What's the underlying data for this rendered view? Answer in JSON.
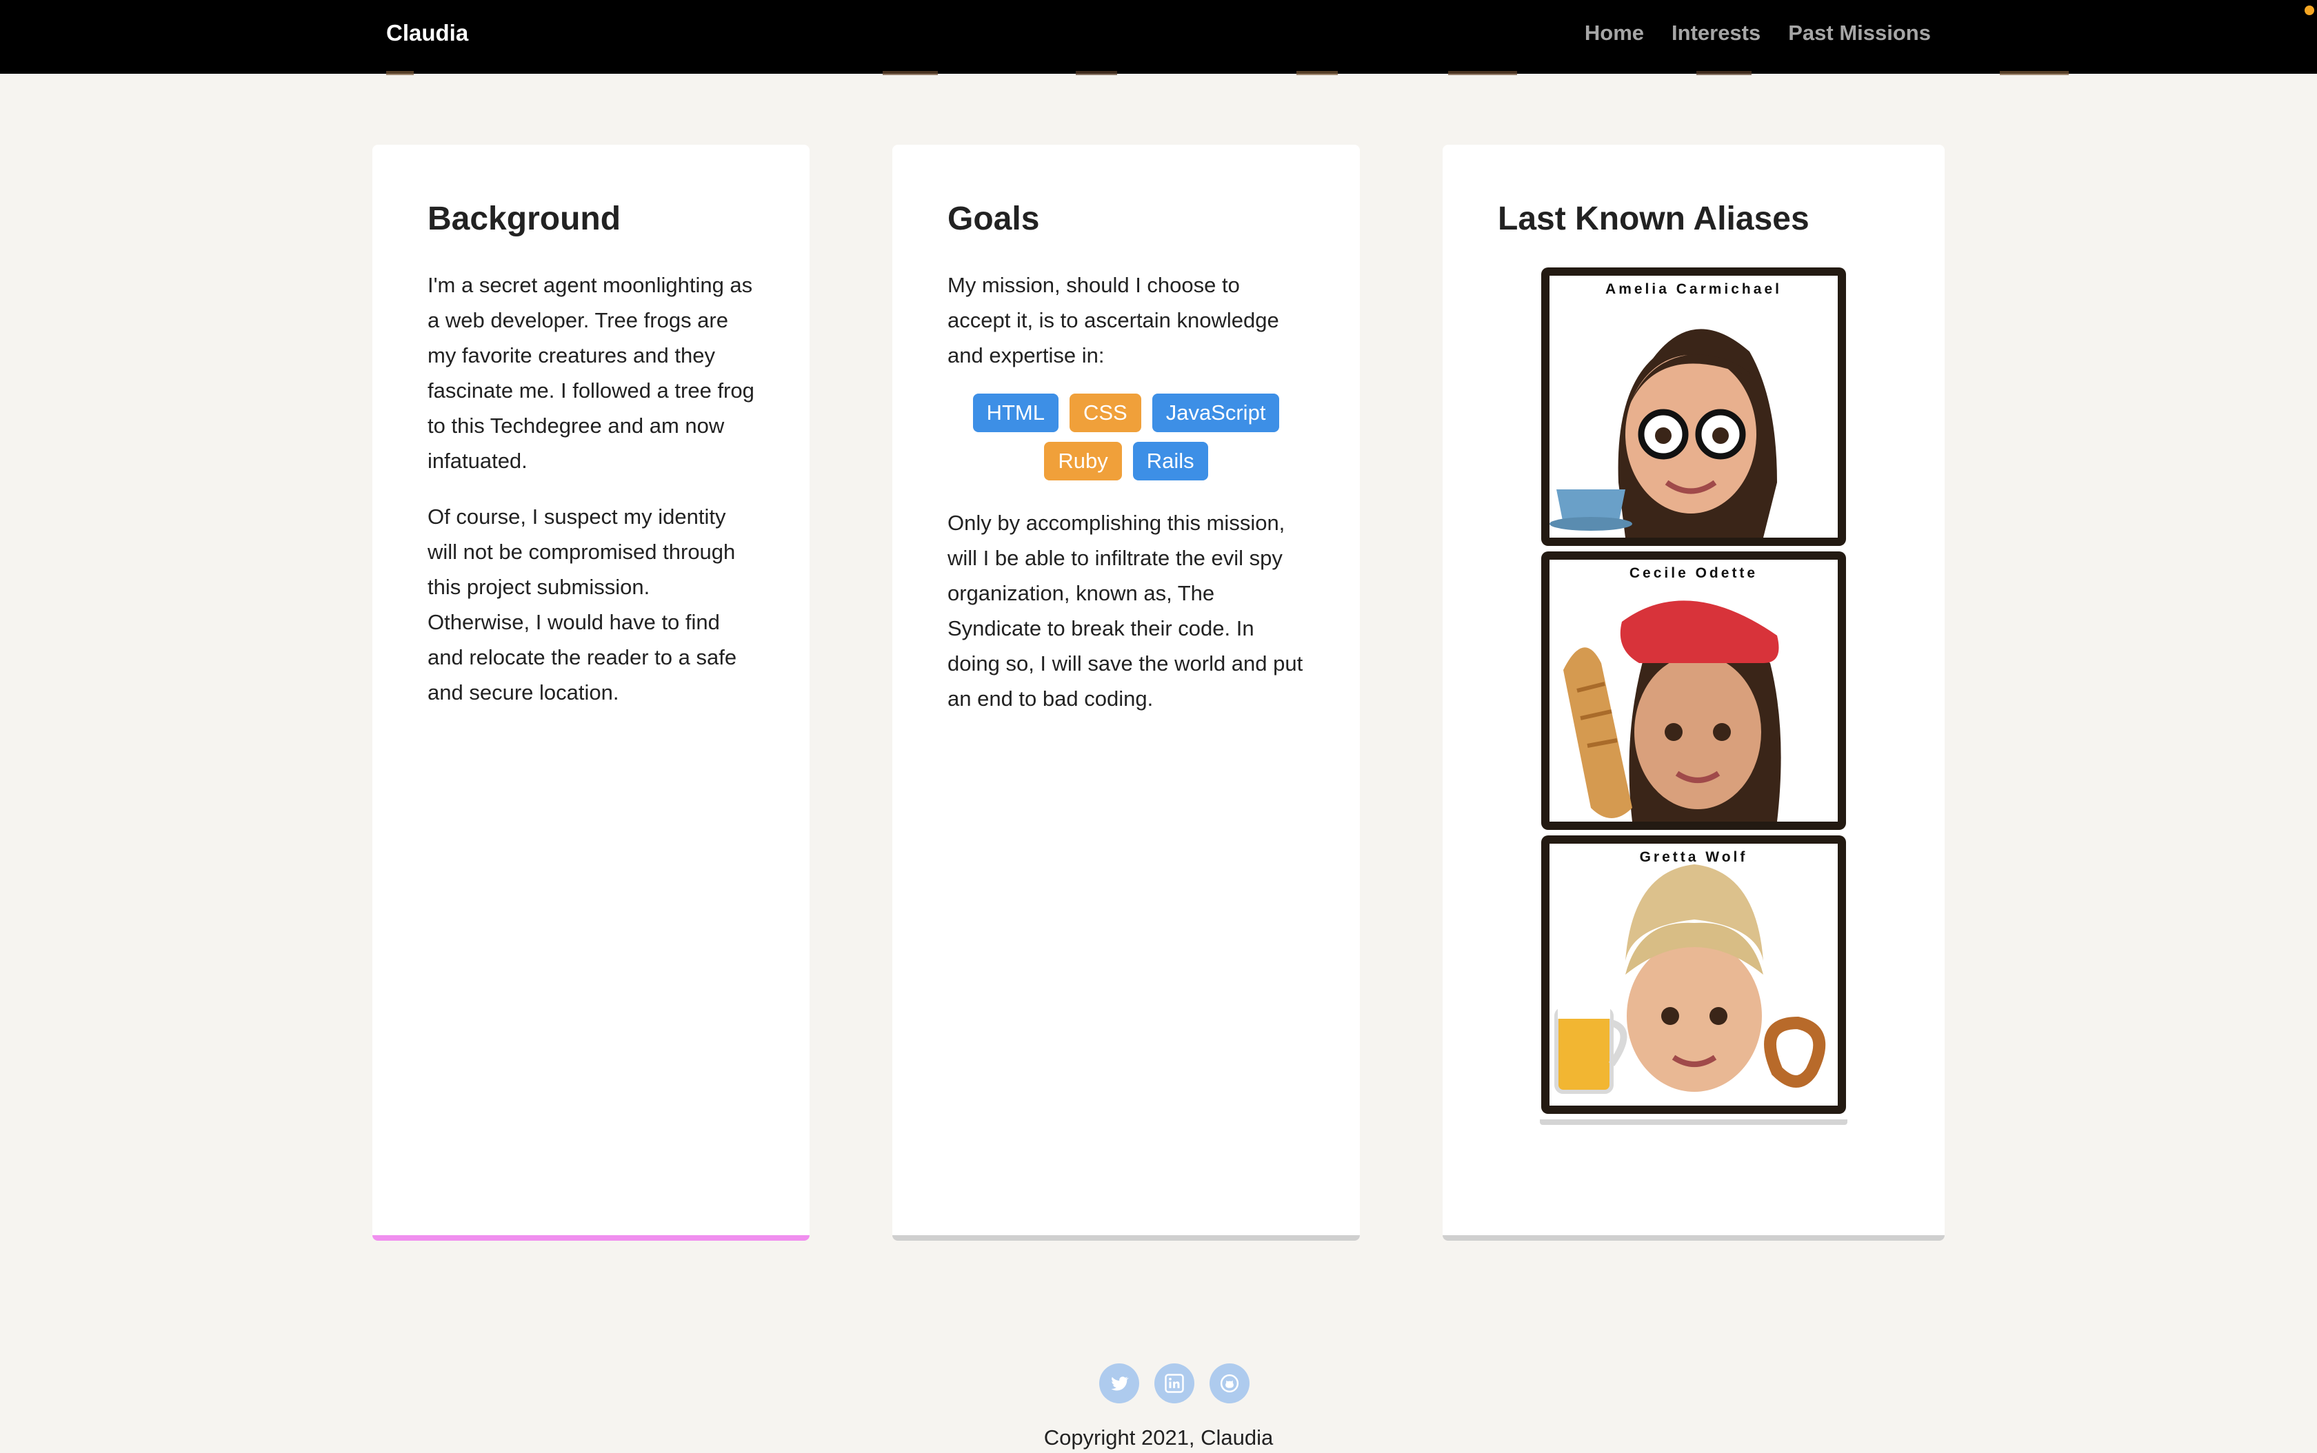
{
  "nav": {
    "brand": "Claudia",
    "links": [
      "Home",
      "Interests",
      "Past Missions"
    ]
  },
  "background": {
    "title": "Background",
    "paragraphs": [
      "I'm a secret agent moonlighting as a web developer. Tree frogs are my favorite creatures and they fascinate me. I followed a tree frog to this Techdegree and am now infatuated.",
      "Of course, I suspect my identity will not be compromised through this project submission. Otherwise, I would have to find and relocate the reader to a safe and secure location."
    ]
  },
  "goals": {
    "title": "Goals",
    "intro": "My mission, should I choose to accept it, is to ascertain knowledge and expertise in:",
    "skills": [
      {
        "label": "HTML",
        "color": "#3d8fe6"
      },
      {
        "label": "CSS",
        "color": "#f0a03a"
      },
      {
        "label": "JavaScript",
        "color": "#3d8fe6"
      },
      {
        "label": "Ruby",
        "color": "#f0a03a"
      },
      {
        "label": "Rails",
        "color": "#3d8fe6"
      }
    ],
    "outro": "Only by accomplishing this mission, will I be able to infiltrate the evil spy organization, known as, The Syndicate to break their code. In doing so, I will save the world and put an end to bad coding."
  },
  "aliases": {
    "title": "Last Known Aliases",
    "items": [
      {
        "name": "Amelia Carmichael"
      },
      {
        "name": "Cecile Odette"
      },
      {
        "name": "Gretta Wolf"
      }
    ]
  },
  "footer": {
    "socials": [
      "twitter-icon",
      "linkedin-icon",
      "github-icon"
    ],
    "copyright": "Copyright 2021, Claudia"
  },
  "colors": {
    "nav_bg": "#000000",
    "page_bg": "#f6f4f0",
    "accent_bottom": "#f08fef",
    "social": "#aecbee"
  }
}
